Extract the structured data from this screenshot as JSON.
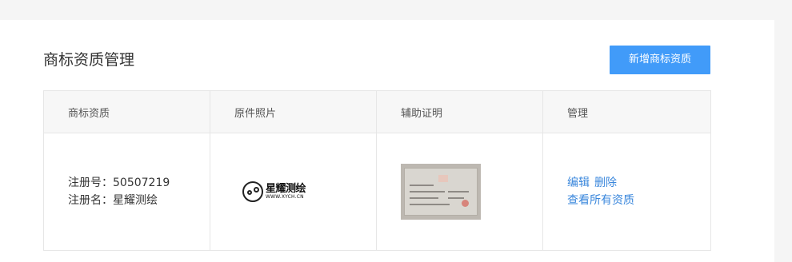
{
  "page": {
    "title": "商标资质管理",
    "add_button": "新增商标资质"
  },
  "table": {
    "columns": [
      "商标资质",
      "原件照片",
      "辅助证明",
      "管理"
    ],
    "rows": [
      {
        "reg_no": "注册号：50507219",
        "reg_name": "注册名：星耀测绘",
        "logo_cn": "星耀测绘",
        "logo_en": "WWW.XYCH.CN",
        "actions": {
          "edit": "编辑",
          "delete": "删除",
          "view_all": "查看所有资质"
        }
      }
    ]
  },
  "colors": {
    "accent": "#419bf9",
    "link": "#3a87dc"
  }
}
